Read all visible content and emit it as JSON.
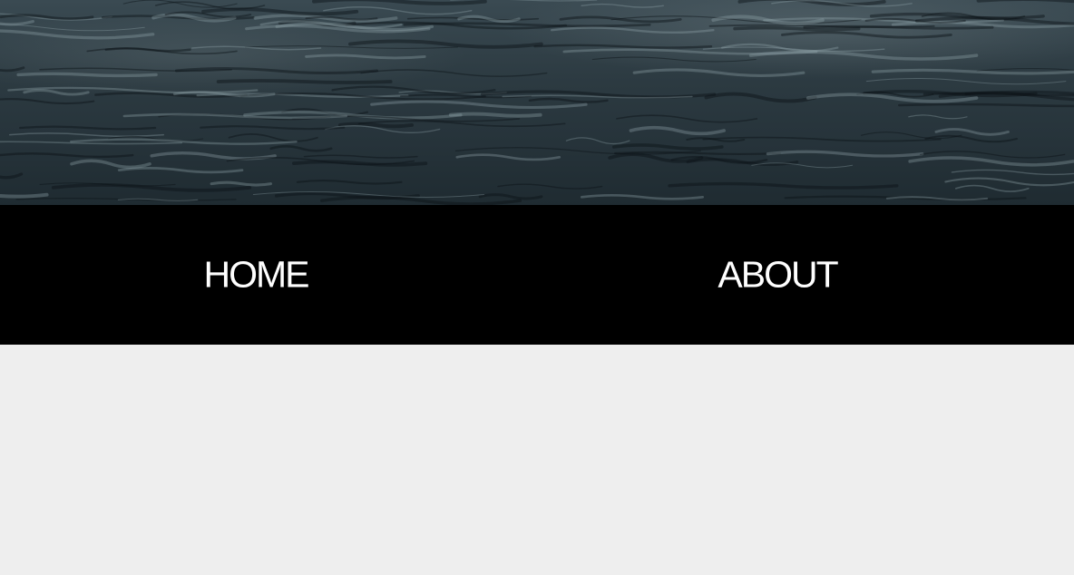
{
  "hero": {
    "image": "ocean-water-photo",
    "colors": {
      "dark": "#1f2b31",
      "mid": "#2c3a41",
      "highlight": "#7a8c94"
    }
  },
  "nav": {
    "background": "#000000",
    "items": [
      {
        "label": "HOME"
      },
      {
        "label": "ABOUT"
      }
    ]
  },
  "content": {
    "background": "#eeeeee"
  }
}
